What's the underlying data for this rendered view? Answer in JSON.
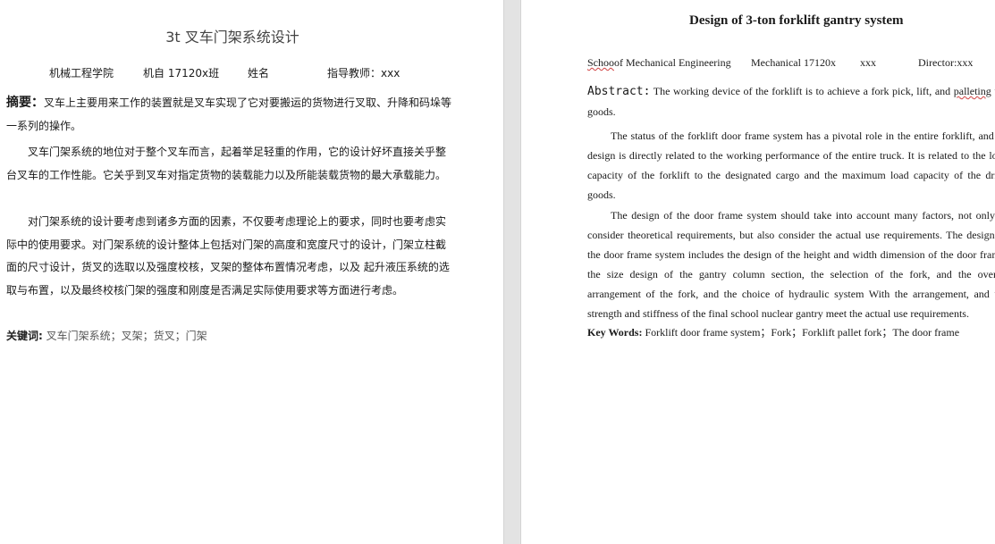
{
  "left_page": {
    "title": "3t 叉车门架系统设计",
    "meta": {
      "school": "机械工程学院",
      "class": "机自 17120x班",
      "name": "姓名",
      "advisor": "指导教师：xxx"
    },
    "abstract_label": "摘要：",
    "abstract_text": "叉车上主要用来工作的装置就是叉车实现了它对要搬运的货物进行叉取、升降和码垛等一系列的操作。",
    "para2": "叉车门架系统的地位对于整个叉车而言，起着举足轻重的作用，它的设计好坏直接关乎整台叉车的工作性能。它关乎到叉车对指定货物的装载能力以及所能装载货物的最大承载能力。",
    "para3": "对门架系统的设计要考虑到诸多方面的因素，不仅要考虑理论上的要求，同时也要考虑实际中的使用要求。对门架系统的设计整体上包括对门架的高度和宽度尺寸的设计，门架立柱截面的尺寸设计，货叉的选取以及强度校核，叉架的整体布置情况考虑，以及 起升液压系统的选取与布置，以及最终校核门架的强度和刚度是否满足实际使用要求等方面进行考虑。",
    "keywords_label": "关键词:",
    "keywords": "叉车门架系统；叉架；货叉；门架"
  },
  "right_page": {
    "title": "Design of 3-ton forklift gantry system",
    "meta": {
      "school_squiggle": "Schoo",
      "school_rest": "of Mechanical Engineering",
      "class": "Mechanical 17120x",
      "name": "xxx",
      "director": "Director:xxx"
    },
    "abstract_label": "Abstract:",
    "abstract_text": " The working device of the forklift is to achieve a fork pick, lift, and ",
    "abstract_squiggle": "palleting",
    "abstract_tail": " the goods.",
    "para2": "The status of the forklift door frame system has a pivotal role in the entire forklift, and its design is directly related to the working performance of the entire truck. It is related to the load capacity of the forklift to the designated cargo and the maximum load capacity of the dried goods.",
    "para3": "The design of the door frame system should take into account many factors, not only to consider theoretical requirements, but also consider the actual use requirements. The design of the door frame system includes the design of the height and width dimension of the door frame, the size design of the gantry column section, the selection of the fork, and the overall arrangement of the fork, and the choice of hydraulic system With the arrangement, and the strength and stiffness of the final school nuclear gantry meet the actual use requirements.",
    "keywords_label": "Key Words:",
    "keywords": " Forklift door frame system；Fork；Forklift pallet fork；The door frame"
  }
}
